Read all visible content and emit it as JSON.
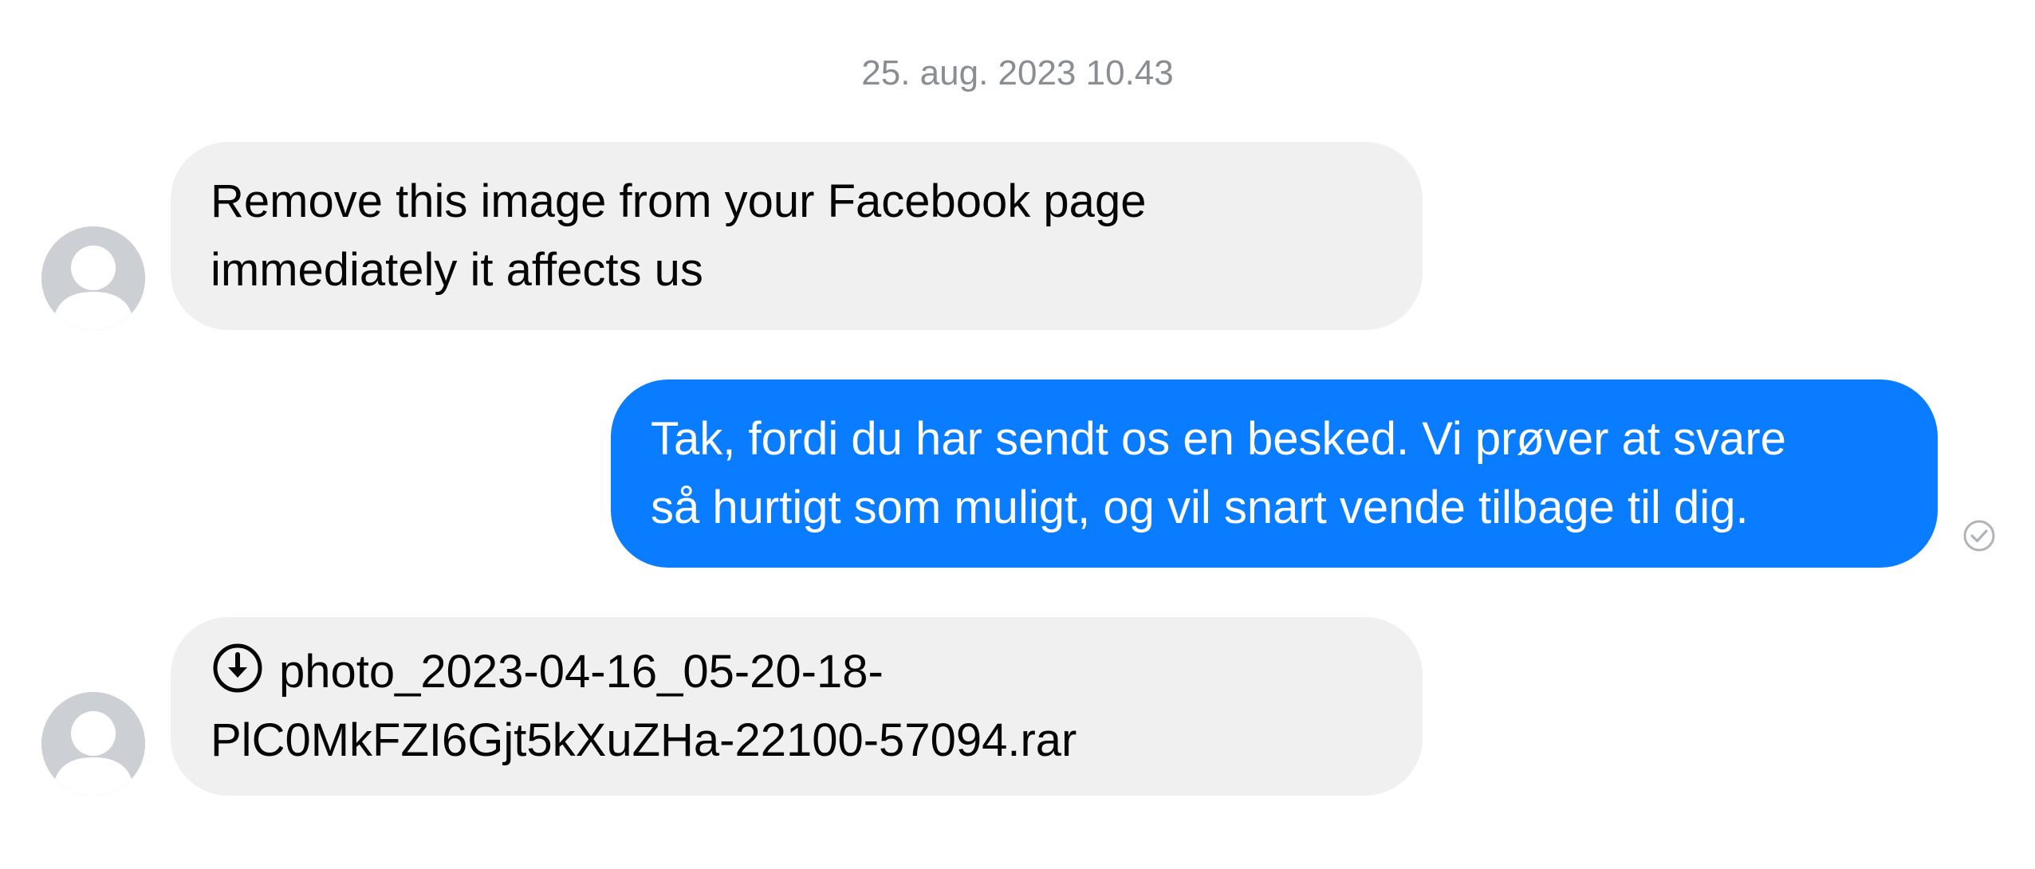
{
  "timestamp": "25. aug. 2023 10.43",
  "messages": [
    {
      "direction": "incoming",
      "lines": [
        "Remove this image from your Facebook page",
        "immediately it affects us"
      ]
    },
    {
      "direction": "outgoing",
      "lines": [
        "Tak, fordi du har sendt os en besked. Vi prøver at svare",
        "så hurtigt som muligt, og vil snart vende tilbage til dig."
      ],
      "status_icon": "seen-check-icon"
    },
    {
      "direction": "incoming",
      "icon": "download-icon",
      "lines": [
        "photo_2023-04-16_05-20-18-",
        "PlC0MkFZI6Gjt5kXuZHa-22100-57094.rar"
      ]
    }
  ],
  "colors": {
    "incoming_bubble": "#f0f0f1",
    "outgoing_bubble": "#0a7cff",
    "timestamp_text": "#8a8d91",
    "avatar_bg": "#ccd0d5"
  }
}
